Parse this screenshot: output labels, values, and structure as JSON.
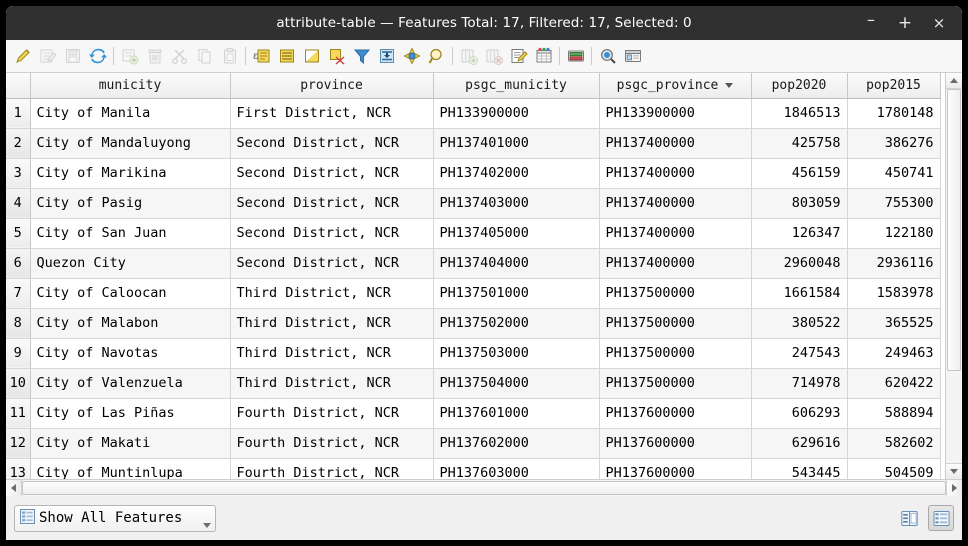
{
  "window": {
    "title": "attribute-table — Features Total: 17, Filtered: 17, Selected: 0",
    "minimize_label": "–",
    "maximize_label": "+",
    "close_label": "×"
  },
  "toolbar": {
    "items": [
      {
        "name": "toggle-editing-icon",
        "tip": "Toggle editing mode",
        "enabled": true
      },
      {
        "name": "multi-edit-icon",
        "tip": "Toggle multi edit mode",
        "enabled": false
      },
      {
        "name": "save-edits-icon",
        "tip": "Save edits",
        "enabled": false
      },
      {
        "name": "reload-icon",
        "tip": "Reload the table",
        "enabled": true
      },
      {
        "sep": true
      },
      {
        "name": "add-feature-icon",
        "tip": "Add feature",
        "enabled": false
      },
      {
        "name": "delete-selected-icon",
        "tip": "Delete selected features",
        "enabled": false
      },
      {
        "name": "cut-features-icon",
        "tip": "Cut selected features",
        "enabled": false
      },
      {
        "name": "copy-features-icon",
        "tip": "Copy selected features",
        "enabled": false
      },
      {
        "name": "paste-features-icon",
        "tip": "Paste features",
        "enabled": false
      },
      {
        "sep": true
      },
      {
        "name": "select-by-expression-icon",
        "tip": "Select features using an expression",
        "enabled": true
      },
      {
        "name": "select-all-icon",
        "tip": "Select all features",
        "enabled": true
      },
      {
        "name": "invert-selection-icon",
        "tip": "Invert selection",
        "enabled": true
      },
      {
        "name": "deselect-all-icon",
        "tip": "Deselect all features",
        "enabled": true
      },
      {
        "name": "filter-selected-icon",
        "tip": "Filter / select features",
        "enabled": true
      },
      {
        "name": "move-selection-to-top-icon",
        "tip": "Move selection to top",
        "enabled": true
      },
      {
        "name": "pan-to-selected-icon",
        "tip": "Pan map to selected rows",
        "enabled": true
      },
      {
        "name": "zoom-to-selected-icon",
        "tip": "Zoom map to selected rows",
        "enabled": true
      },
      {
        "sep": true
      },
      {
        "name": "new-field-icon",
        "tip": "New field",
        "enabled": false
      },
      {
        "name": "delete-field-icon",
        "tip": "Delete field",
        "enabled": false
      },
      {
        "name": "open-field-calculator-icon",
        "tip": "Open field calculator",
        "enabled": true
      },
      {
        "name": "conditional-formatting-icon",
        "tip": "Conditional formatting",
        "enabled": true
      },
      {
        "sep": true
      },
      {
        "name": "organize-columns-icon",
        "tip": "Organize columns",
        "enabled": true
      },
      {
        "sep": true
      },
      {
        "name": "actions-icon",
        "tip": "Actions",
        "enabled": true
      },
      {
        "name": "form-view-toggle-icon",
        "tip": "Dock attribute table",
        "enabled": true
      }
    ]
  },
  "table": {
    "columns": [
      {
        "key": "idx",
        "label": "",
        "align": "center",
        "sorted": false
      },
      {
        "key": "municity",
        "label": "municity",
        "align": "left",
        "sorted": false
      },
      {
        "key": "province",
        "label": "province",
        "align": "left",
        "sorted": false
      },
      {
        "key": "psgc_municity",
        "label": "psgc_municity",
        "align": "left",
        "sorted": false
      },
      {
        "key": "psgc_province",
        "label": "psgc_province",
        "align": "left",
        "sorted": true
      },
      {
        "key": "pop2020",
        "label": "pop2020",
        "align": "right",
        "sorted": false
      },
      {
        "key": "pop2015",
        "label": "pop2015",
        "align": "right",
        "sorted": false
      }
    ],
    "rows": [
      {
        "idx": "1",
        "municity": "City of Manila",
        "province": "First District, NCR",
        "psgc_municity": "PH133900000",
        "psgc_province": "PH133900000",
        "pop2020": "1846513",
        "pop2015": "1780148"
      },
      {
        "idx": "2",
        "municity": "City of Mandaluyong",
        "province": "Second District, NCR",
        "psgc_municity": "PH137401000",
        "psgc_province": "PH137400000",
        "pop2020": "425758",
        "pop2015": "386276"
      },
      {
        "idx": "3",
        "municity": "City of Marikina",
        "province": "Second District, NCR",
        "psgc_municity": "PH137402000",
        "psgc_province": "PH137400000",
        "pop2020": "456159",
        "pop2015": "450741"
      },
      {
        "idx": "4",
        "municity": "City of Pasig",
        "province": "Second District, NCR",
        "psgc_municity": "PH137403000",
        "psgc_province": "PH137400000",
        "pop2020": "803059",
        "pop2015": "755300"
      },
      {
        "idx": "5",
        "municity": "City of San Juan",
        "province": "Second District, NCR",
        "psgc_municity": "PH137405000",
        "psgc_province": "PH137400000",
        "pop2020": "126347",
        "pop2015": "122180"
      },
      {
        "idx": "6",
        "municity": "Quezon City",
        "province": "Second District, NCR",
        "psgc_municity": "PH137404000",
        "psgc_province": "PH137400000",
        "pop2020": "2960048",
        "pop2015": "2936116"
      },
      {
        "idx": "7",
        "municity": "City of Caloocan",
        "province": "Third District, NCR",
        "psgc_municity": "PH137501000",
        "psgc_province": "PH137500000",
        "pop2020": "1661584",
        "pop2015": "1583978"
      },
      {
        "idx": "8",
        "municity": "City of Malabon",
        "province": "Third District, NCR",
        "psgc_municity": "PH137502000",
        "psgc_province": "PH137500000",
        "pop2020": "380522",
        "pop2015": "365525"
      },
      {
        "idx": "9",
        "municity": "City of Navotas",
        "province": "Third District, NCR",
        "psgc_municity": "PH137503000",
        "psgc_province": "PH137500000",
        "pop2020": "247543",
        "pop2015": "249463"
      },
      {
        "idx": "10",
        "municity": "City of Valenzuela",
        "province": "Third District, NCR",
        "psgc_municity": "PH137504000",
        "psgc_province": "PH137500000",
        "pop2020": "714978",
        "pop2015": "620422"
      },
      {
        "idx": "11",
        "municity": "City of Las Piñas",
        "province": "Fourth District, NCR",
        "psgc_municity": "PH137601000",
        "psgc_province": "PH137600000",
        "pop2020": "606293",
        "pop2015": "588894"
      },
      {
        "idx": "12",
        "municity": "City of Makati",
        "province": "Fourth District, NCR",
        "psgc_municity": "PH137602000",
        "psgc_province": "PH137600000",
        "pop2020": "629616",
        "pop2015": "582602"
      },
      {
        "idx": "13",
        "municity": "City of Muntinlupa",
        "province": "Fourth District, NCR",
        "psgc_municity": "PH137603000",
        "psgc_province": "PH137600000",
        "pop2020": "543445",
        "pop2015": "504509"
      }
    ]
  },
  "bottom": {
    "filter_label": "Show All Features",
    "filter_icon": "table-list-icon",
    "form_view_label": "form-view",
    "table_view_label": "table-view",
    "active_view": "table-view"
  },
  "colors": {
    "titlebar_bg": "#303030",
    "toolbar_bg": "#f7f7f7",
    "header_bg": "#ededed",
    "row_alt_bg": "#f6f6f6",
    "accent_yellow": "#f2d14b",
    "accent_blue": "#2f8fd8",
    "window_bg": "#f0f0f0"
  }
}
